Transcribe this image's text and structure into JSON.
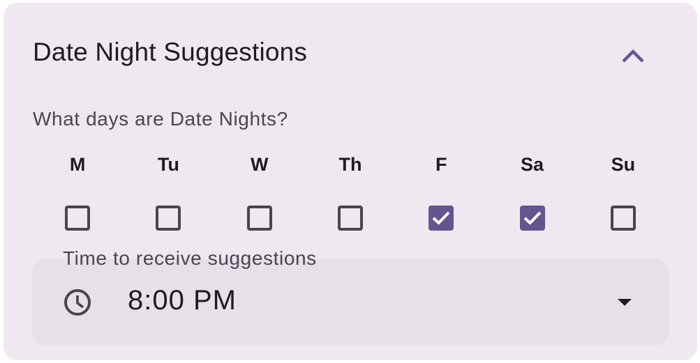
{
  "card": {
    "title": "Date Night Suggestions",
    "collapse_icon": "chevron-up-icon"
  },
  "days_section": {
    "question": "What days are Date Nights?",
    "days": [
      {
        "label": "M",
        "checked": false
      },
      {
        "label": "Tu",
        "checked": false
      },
      {
        "label": "W",
        "checked": false
      },
      {
        "label": "Th",
        "checked": false
      },
      {
        "label": "F",
        "checked": true
      },
      {
        "label": "Sa",
        "checked": true
      },
      {
        "label": "Su",
        "checked": false
      }
    ]
  },
  "time_field": {
    "label": "Time to receive suggestions",
    "value": "8:00 PM",
    "leading_icon": "clock-icon",
    "trailing_icon": "dropdown-arrow-icon"
  },
  "colors": {
    "card_background": "#efe8f0",
    "accent": "#65558f",
    "field_background": "#e6e0e9",
    "text_primary": "#1d1b20",
    "text_secondary": "#49454f"
  }
}
